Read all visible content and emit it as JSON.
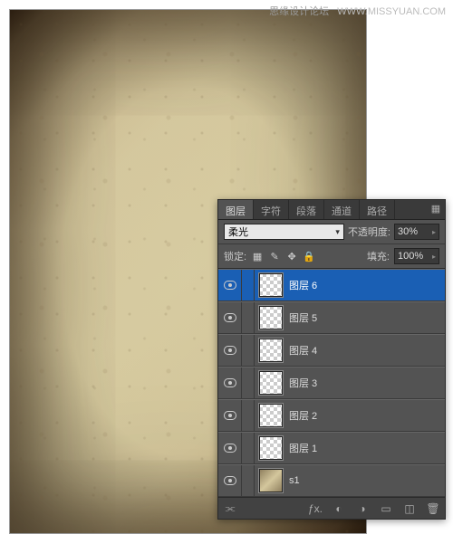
{
  "watermark": {
    "site": "思缘设计论坛",
    "url": "WWW.MISSYUAN.COM"
  },
  "panel": {
    "tabs": [
      "图层",
      "字符",
      "段落",
      "通道",
      "路径"
    ],
    "active_tab": 0,
    "blend_mode": "柔光",
    "opacity_label": "不透明度:",
    "opacity_value": "30%",
    "lock_label": "锁定:",
    "fill_label": "填充:",
    "fill_value": "100%",
    "layers": [
      {
        "name": "图层 6",
        "selected": true,
        "thumb": "transparent"
      },
      {
        "name": "图层 5",
        "selected": false,
        "thumb": "transparent"
      },
      {
        "name": "图层 4",
        "selected": false,
        "thumb": "transparent"
      },
      {
        "name": "图层 3",
        "selected": false,
        "thumb": "transparent"
      },
      {
        "name": "图层 2",
        "selected": false,
        "thumb": "transparent"
      },
      {
        "name": "图层 1",
        "selected": false,
        "thumb": "transparent"
      },
      {
        "name": "s1",
        "selected": false,
        "thumb": "texture"
      }
    ]
  }
}
